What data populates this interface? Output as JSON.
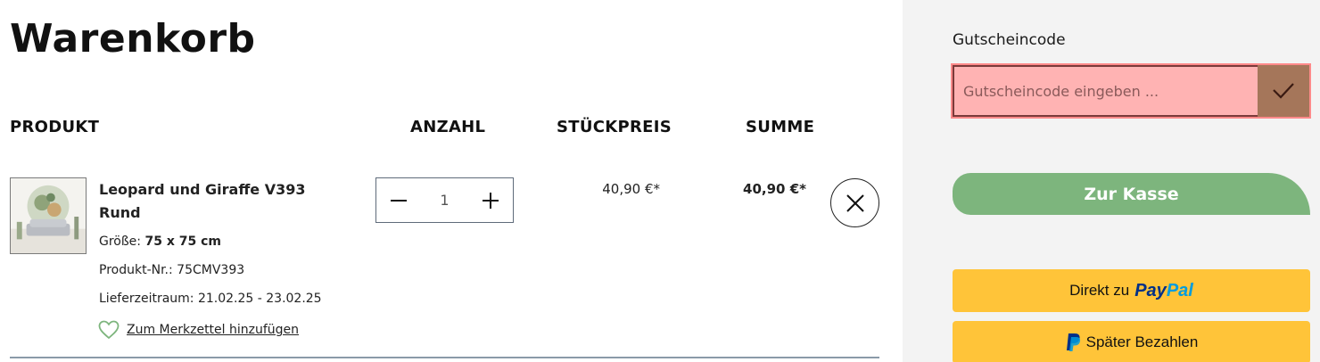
{
  "cart": {
    "title": "Warenkorb",
    "columns": {
      "product": "PRODUKT",
      "quantity": "ANZAHL",
      "unit_price": "STÜCKPREIS",
      "sum": "SUMME"
    },
    "items": [
      {
        "name": "Leopard und Giraffe V393 Rund",
        "size_label": "Größe:",
        "size_value": "75 x 75 cm",
        "product_nr": "Produkt-Nr.: 75CMV393",
        "delivery": "Lieferzeitraum: 21.02.25 - 23.02.25",
        "wishlist_label": "Zum Merkzettel hinzufügen",
        "quantity": "1",
        "unit_price": "40,90 €*",
        "sum": "40,90 €*"
      }
    ]
  },
  "sidebar": {
    "coupon_label": "Gutscheincode",
    "coupon_placeholder": "Gutscheincode eingeben ...",
    "checkout_label": "Zur Kasse",
    "paypal_prefix": "Direkt zu",
    "paypal_brand_pay": "Pay",
    "paypal_brand_pal": "Pal",
    "paypal_later_label": "Später Bezahlen"
  },
  "colors": {
    "sidebar_bg": "#f3f3f3",
    "checkout_green": "#7db57d",
    "paypal_yellow": "#ffc439",
    "coupon_highlight": "#ffb3b3",
    "coupon_button": "#a5765a"
  },
  "icons": {
    "minus": "minus-icon",
    "plus": "plus-icon",
    "remove": "close-icon",
    "coupon_submit": "checkmark-icon",
    "wishlist": "heart-icon",
    "paypal": "paypal-icon"
  }
}
